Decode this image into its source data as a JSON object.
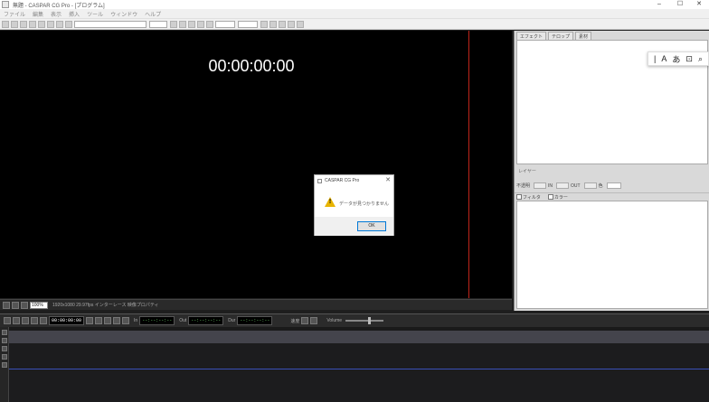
{
  "window": {
    "title": "無題 - CASPAR CG Pro - [プログラム]",
    "controls": [
      "–",
      "☐",
      "✕"
    ]
  },
  "menu": [
    "ファイル",
    "編集",
    "表示",
    "挿入",
    "ツール",
    "ウィンドウ",
    "ヘルプ"
  ],
  "preview": {
    "timecode": "00:00:00:00",
    "status_zoom": "100%",
    "status_text": "1920x1080 29.97fps インターレース 映像プロパティ"
  },
  "right_panel": {
    "tabs": [
      "エフェクト",
      "テロップ",
      "素材"
    ],
    "floating_tools": [
      "|",
      "A",
      "あ",
      "⊡",
      "⌕"
    ],
    "mid_label": "レイヤー",
    "controls": [
      "不透明",
      "IN",
      "OUT",
      "色"
    ],
    "header": [
      "フィルタ",
      "カラー"
    ]
  },
  "transport": {
    "current_tc": "00:00:00:00",
    "in_label": "In",
    "in_tc": "--:--:--:--",
    "out_label": "Out",
    "out_tc": "--:--:--:--",
    "dur_label": "Dur",
    "dur_tc": "--:--:--:--",
    "speed_label": "速度",
    "volume_label": "Volume",
    "volume_level": 0.6
  },
  "dialog": {
    "title": "CASPAR CG Pro",
    "message": "データが見つかりません",
    "ok": "OK",
    "close": "✕"
  },
  "colors": {
    "accent_red": "#c0261b",
    "timeline_blue": "#3a4fb8",
    "warning_yellow": "#e8b400"
  }
}
